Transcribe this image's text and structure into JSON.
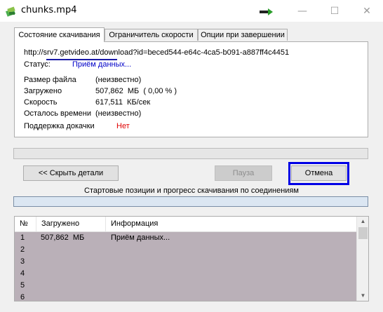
{
  "window": {
    "title": "chunks.mp4",
    "minimize_glyph": "—",
    "maximize_glyph": "☐",
    "close_glyph": "✕"
  },
  "tabs": [
    {
      "label": "Состояние скачивания",
      "active": true
    },
    {
      "label": "Ограничитель скорости",
      "active": false
    },
    {
      "label": "Опции при завершении",
      "active": false
    }
  ],
  "status": {
    "url_prefix": "http://",
    "url_host": "srv7.getvideo.at",
    "url_rest": "/download?id=beced544-e64c-4ca5-b091-a887ff4c4451",
    "status_label": "Статус:",
    "status_value": "Приём данных...",
    "file_size_label": "Размер файла",
    "file_size_value": "(неизвестно)",
    "downloaded_label": "Загружено",
    "downloaded_value": "507,862  МБ  ( 0,00 % )",
    "speed_label": "Скорость",
    "speed_value": "617,511  КБ/сек",
    "time_left_label": "Осталось времени",
    "time_left_value": "(неизвестно)",
    "resume_label": "Поддержка докачки",
    "resume_value": "Нет"
  },
  "buttons": {
    "hide_details": "<< Скрыть детали",
    "pause": "Пауза",
    "cancel": "Отмена"
  },
  "connections_caption": "Стартовые позиции и прогресс скачивания по соединениям",
  "table": {
    "columns": [
      "№",
      "Загружено",
      "Информация"
    ],
    "rows": [
      {
        "num": "1",
        "downloaded": "507,862  МБ",
        "info": "Приём данных..."
      },
      {
        "num": "2",
        "downloaded": "",
        "info": ""
      },
      {
        "num": "3",
        "downloaded": "",
        "info": ""
      },
      {
        "num": "4",
        "downloaded": "",
        "info": ""
      },
      {
        "num": "5",
        "downloaded": "",
        "info": ""
      },
      {
        "num": "6",
        "downloaded": "",
        "info": ""
      }
    ]
  },
  "colors": {
    "accent_blue": "#0000e6",
    "status_blue": "#0000c8",
    "no_red": "#e00000",
    "table_bg": "#bab0b8"
  }
}
